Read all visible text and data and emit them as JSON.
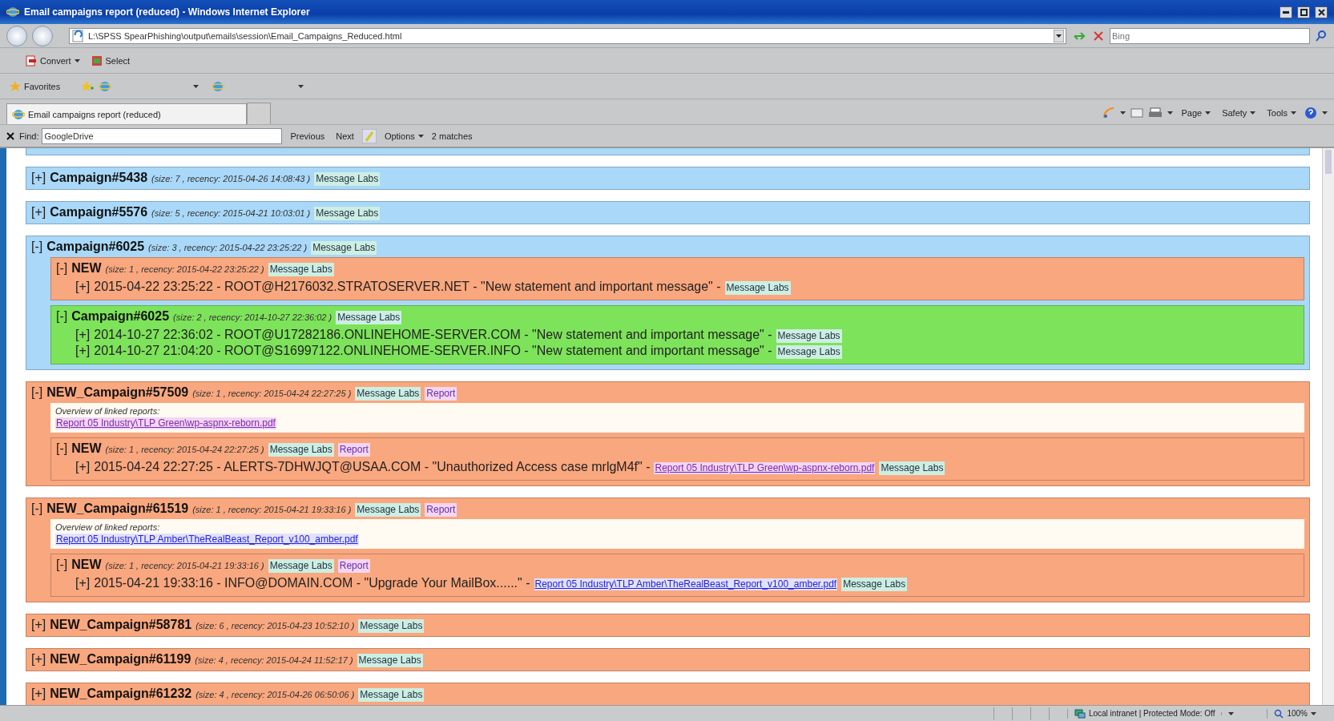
{
  "window": {
    "title": "Email campaigns report (reduced) - Windows Internet Explorer"
  },
  "address_bar": {
    "url": "L:\\SPSS SpearPhishing\\output\\emails\\session\\Email_Campaigns_Reduced.html",
    "search_placeholder": "Bing"
  },
  "command_bar": [
    {
      "label": "Convert",
      "dropdown": true
    },
    {
      "label": "Select",
      "dropdown": false
    }
  ],
  "favorites_bar": {
    "label": "Favorites"
  },
  "tabs": [
    {
      "title": "Email campaigns report (reduced)",
      "selected": true
    }
  ],
  "page_tools": [
    "Page",
    "Safety",
    "Tools"
  ],
  "find_bar": {
    "label": "Find:",
    "value": "GoogleDrive",
    "buttons": [
      "Previous",
      "Next"
    ],
    "options": "Options",
    "matches": "2 matches"
  },
  "campaigns": [
    {
      "toggle": "[+]",
      "name": "Campaign#5438",
      "meta": "(size: 7 , recency: 2015-04-26 14:08:43 )",
      "color": "#a9d8f8",
      "tags": [
        {
          "kind": "labs",
          "text": "Message Labs"
        }
      ]
    },
    {
      "toggle": "[+]",
      "name": "Campaign#5576",
      "meta": "(size: 5 , recency: 2015-04-21 10:03:01 )",
      "color": "#a9d8f8",
      "tags": [
        {
          "kind": "labs",
          "text": "Message Labs"
        }
      ]
    },
    {
      "toggle": "[-]",
      "name": "Campaign#6025",
      "meta": "(size: 3 , recency: 2015-04-22 23:25:22 )",
      "color": "#a9d8f8",
      "tags": [
        {
          "kind": "labs",
          "text": "Message Labs"
        }
      ],
      "children": [
        {
          "toggle": "[-]",
          "name": "NEW",
          "meta": "(size: 1 , recency: 2015-04-22 23:25:22 )",
          "color": "#f9a77e",
          "tags": [
            {
              "kind": "labs",
              "text": "Message Labs"
            }
          ],
          "messages": [
            {
              "toggle": "[+]",
              "text": "2015-04-22 23:25:22 - ROOT@H2176032.STRATOSERVER.NET - \"New statement and important message\" -",
              "tags": [
                {
                  "kind": "labs",
                  "text": "Message Labs"
                }
              ]
            }
          ]
        },
        {
          "toggle": "[-]",
          "name": "Campaign#6025",
          "meta": "(size: 2 , recency: 2014-10-27 22:36:02 )",
          "color": "#7de35a",
          "tags": [
            {
              "kind": "labs",
              "text": "Message Labs"
            }
          ],
          "messages": [
            {
              "toggle": "[+]",
              "text": "2014-10-27 22:36:02 - ROOT@U17282186.ONLINEHOME-SERVER.COM - \"New statement and important message\" -",
              "tags": [
                {
                  "kind": "labs",
                  "text": "Message Labs"
                }
              ]
            },
            {
              "toggle": "[+]",
              "text": "2014-10-27 21:04:20 - ROOT@S16997122.ONLINEHOME-SERVER.INFO - \"New statement and important message\" -",
              "tags": [
                {
                  "kind": "labs",
                  "text": "Message Labs"
                }
              ]
            }
          ]
        }
      ]
    },
    {
      "toggle": "[-]",
      "name": "NEW_Campaign#57509",
      "meta": "(size: 1 , recency: 2015-04-24 22:27:25 )",
      "color": "#f9a77e",
      "tags": [
        {
          "kind": "labs",
          "text": "Message Labs"
        },
        {
          "kind": "report",
          "text": "Report"
        }
      ],
      "overview": {
        "label": "Overview of linked reports:",
        "links": [
          {
            "text": "Report 05 Industry\\TLP Green\\wp-aspnx-reborn.pdf",
            "visited": true
          }
        ]
      },
      "children": [
        {
          "toggle": "[-]",
          "name": "NEW",
          "meta": "(size: 1 , recency: 2015-04-24 22:27:25 )",
          "color": "#f9a77e",
          "tags": [
            {
              "kind": "labs",
              "text": "Message Labs"
            },
            {
              "kind": "report",
              "text": "Report"
            }
          ],
          "messages": [
            {
              "toggle": "[+]",
              "text": "2015-04-24 22:27:25 - ALERTS-7DHWJQT@USAA.COM - \"Unauthorized Access case mrlgM4f\" -",
              "link": {
                "text": "Report 05 Industry\\TLP Green\\wp-aspnx-reborn.pdf",
                "visited": true
              },
              "tags": [
                {
                  "kind": "labs",
                  "text": "Message Labs"
                }
              ]
            }
          ]
        }
      ]
    },
    {
      "toggle": "[-]",
      "name": "NEW_Campaign#61519",
      "meta": "(size: 1 , recency: 2015-04-21 19:33:16 )",
      "color": "#f9a77e",
      "tags": [
        {
          "kind": "labs",
          "text": "Message Labs"
        },
        {
          "kind": "report",
          "text": "Report"
        }
      ],
      "overview": {
        "label": "Overview of linked reports:",
        "links": [
          {
            "text": "Report 05 Industry\\TLP Amber\\TheRealBeast_Report_v100_amber.pdf",
            "visited": false
          }
        ]
      },
      "children": [
        {
          "toggle": "[-]",
          "name": "NEW",
          "meta": "(size: 1 , recency: 2015-04-21 19:33:16 )",
          "color": "#f9a77e",
          "tags": [
            {
              "kind": "labs",
              "text": "Message Labs"
            },
            {
              "kind": "report",
              "text": "Report"
            }
          ],
          "messages": [
            {
              "toggle": "[+]",
              "text": "2015-04-21 19:33:16 - INFO@DOMAIN.COM - \"Upgrade Your MailBox......\" -",
              "link": {
                "text": "Report 05 Industry\\TLP Amber\\TheRealBeast_Report_v100_amber.pdf",
                "visited": false
              },
              "tags": [
                {
                  "kind": "labs",
                  "text": "Message Labs"
                }
              ]
            }
          ]
        }
      ]
    },
    {
      "toggle": "[+]",
      "name": "NEW_Campaign#58781",
      "meta": "(size: 6 , recency: 2015-04-23 10:52:10 )",
      "color": "#f9a77e",
      "tags": [
        {
          "kind": "labs",
          "text": "Message Labs"
        }
      ]
    },
    {
      "toggle": "[+]",
      "name": "NEW_Campaign#61199",
      "meta": "(size: 4 , recency: 2015-04-24 11:52:17 )",
      "color": "#f9a77e",
      "tags": [
        {
          "kind": "labs",
          "text": "Message Labs"
        }
      ]
    },
    {
      "toggle": "[+]",
      "name": "NEW_Campaign#61232",
      "meta": "(size: 4 , recency: 2015-04-26 06:50:06 )",
      "color": "#f9a77e",
      "tags": [
        {
          "kind": "labs",
          "text": "Message Labs"
        }
      ]
    }
  ],
  "status_bar": {
    "zone": "Local intranet | Protected Mode: Off",
    "zoom": "100%"
  }
}
